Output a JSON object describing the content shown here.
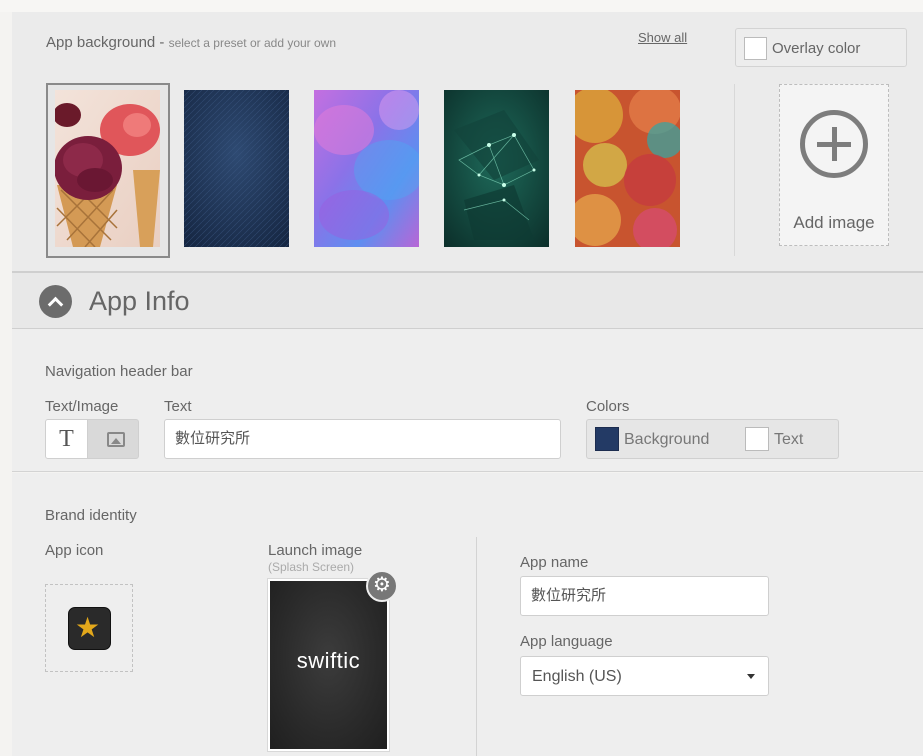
{
  "app_background": {
    "title": "App background",
    "separator": " - ",
    "subtitle": "select a preset or add your own",
    "show_all": "Show all",
    "overlay_label": "Overlay color",
    "add_image_label": "Add image",
    "presets": [
      "ice-cream",
      "dark-blue-texture",
      "purple-blur",
      "green-polygon-network",
      "colorful-bokeh"
    ],
    "selected_preset": 0
  },
  "app_info": {
    "title": "App Info"
  },
  "nav_header": {
    "section_label": "Navigation header bar",
    "text_image_label": "Text/Image",
    "text_toggle_glyph": "T",
    "text_label": "Text",
    "text_value": "數位研究所",
    "colors_label": "Colors",
    "background_label": "Background",
    "background_color": "#233a65",
    "text_color_label": "Text",
    "text_color": "#ffffff"
  },
  "brand_identity": {
    "section_label": "Brand identity",
    "app_icon_label": "App icon",
    "launch_image_label": "Launch image",
    "launch_image_sublabel": "(Splash Screen)",
    "launch_brand_text": "swiftic",
    "app_name_label": "App name",
    "app_name_value": "數位研究所",
    "app_language_label": "App language",
    "app_language_value": "English (US)"
  }
}
